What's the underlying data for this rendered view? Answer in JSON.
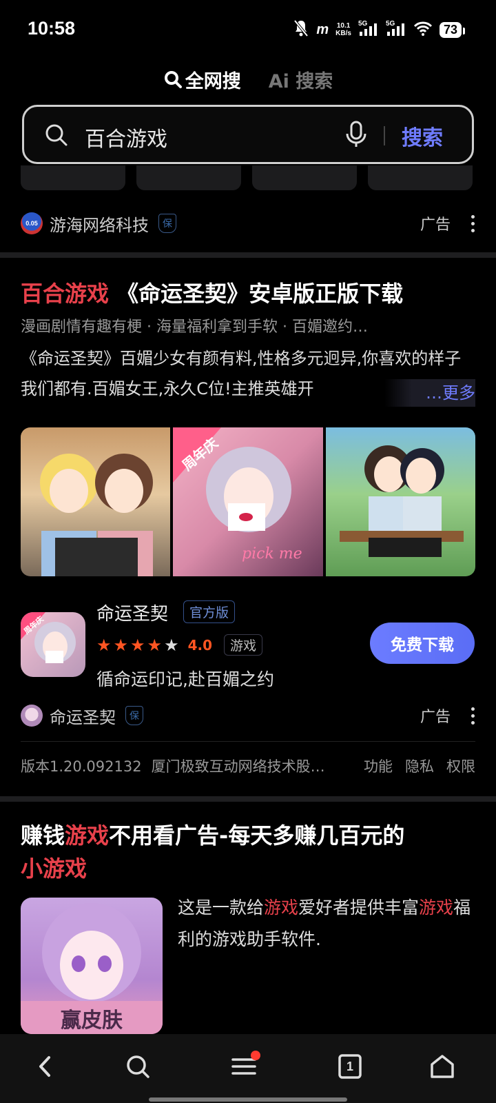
{
  "status_bar": {
    "time": "10:58",
    "net_speed_top": "10.1",
    "net_speed_bottom": "KB/s",
    "battery": "73",
    "icons": [
      "mute-icon",
      "signal-5g-icon",
      "wifi-icon",
      "battery-icon"
    ]
  },
  "tabs": [
    {
      "label": "全网搜",
      "active": true
    },
    {
      "label": "Ai 搜索",
      "active": false
    }
  ],
  "search": {
    "query": "百合游戏",
    "button_label": "搜索"
  },
  "ad1": {
    "brand": "游海网络科技",
    "brand_logo_text": "0.05",
    "bao": "保",
    "ad_label": "广告"
  },
  "result1": {
    "title_highlight": "百合游戏",
    "title_rest": " 《命运圣契》安卓版正版下载",
    "subline": "漫画剧情有趣有梗 · 海量福利拿到手软 · 百媚邀约…",
    "desc": "《命运圣契》百媚少女有颜有料,性格多元迥异,你喜欢的样子我们都有.百媚女王,永久C位!主推英雄开",
    "more": "…更多",
    "gallery_labels": [
      "周年庆",
      "pick me"
    ],
    "app": {
      "name": "命运圣契",
      "badge": "官方版",
      "rating": "4.0",
      "rating_value": 4.0,
      "category": "游戏",
      "slogan": "循命运印记,赴百媚之约",
      "download_label": "免费下载",
      "icon_label": "周年庆"
    },
    "source": {
      "name": "命运圣契",
      "bao": "保",
      "ad_label": "广告"
    },
    "meta": {
      "version": "版本1.20.092132",
      "developer": "厦门极致互动网络技术股…",
      "links": [
        "功能",
        "隐私",
        "权限"
      ]
    }
  },
  "result2": {
    "title_part1": "赚钱",
    "title_hl1": "游戏",
    "title_part2": "不用看广告-每天多赚几百元的",
    "title_hl2": "小游戏",
    "desc_part1": "这是一款给",
    "desc_hl1": "游戏",
    "desc_part2": "爱好者提供丰富",
    "desc_hl2": "游戏",
    "desc_part3": "福利的游戏助手软件.",
    "image_label": "赢皮肤"
  },
  "bottom_nav": [
    "back-icon",
    "search-icon",
    "menu-icon",
    "tabs-icon",
    "home-icon"
  ],
  "tabs_count": "1",
  "colors": {
    "accent": "#6f7cff",
    "highlight": "#e8414b",
    "star": "#ff5522",
    "background": "#000000"
  }
}
